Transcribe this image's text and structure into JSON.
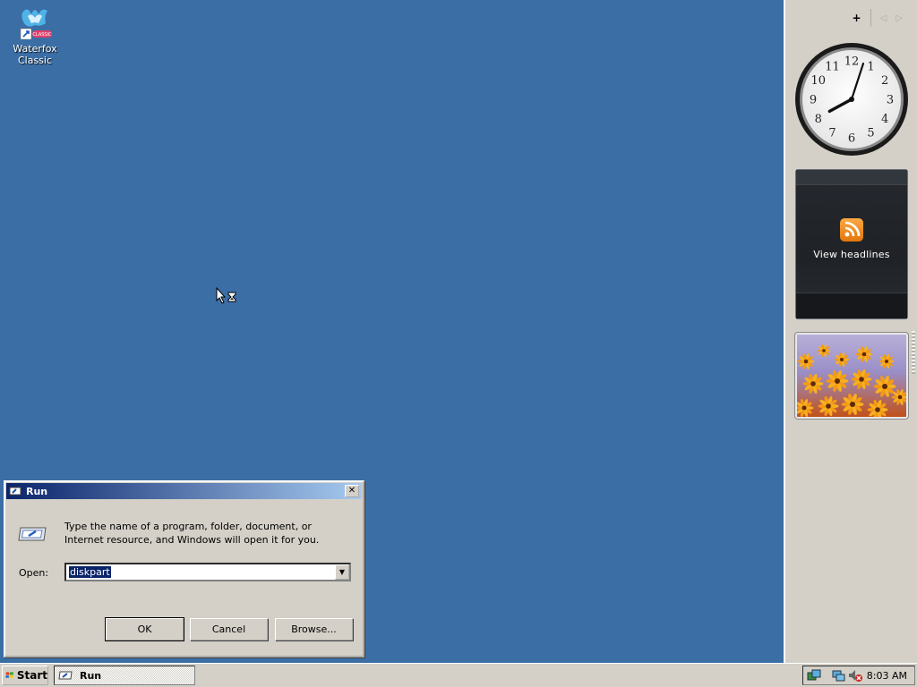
{
  "desktop": {
    "icons": [
      {
        "label_line1": "Waterfox",
        "label_line2": "Classic",
        "badge": "CLASSIC",
        "icon": "waterfox-icon"
      }
    ],
    "background_color": "#3b6ea5"
  },
  "sidebar": {
    "controls": {
      "add": "+",
      "prev": "◁",
      "next": "▷"
    },
    "clock": {
      "numerals": [
        "12",
        "1",
        "2",
        "3",
        "4",
        "5",
        "6",
        "7",
        "8",
        "9",
        "10",
        "11"
      ],
      "hour": 8,
      "minute": 3
    },
    "feed": {
      "caption": "View headlines",
      "icon": "rss-icon"
    },
    "slideshow": {
      "icon": "flower-photo"
    }
  },
  "run_dialog": {
    "title": "Run",
    "close_label": "✕",
    "description": "Type the name of a program, folder, document, or Internet resource, and Windows will open it for you.",
    "open_label": "Open:",
    "open_value": "diskpart",
    "buttons": {
      "ok": "OK",
      "cancel": "Cancel",
      "browse": "Browse..."
    }
  },
  "taskbar": {
    "start_label": "Start",
    "tasks": [
      {
        "label": "Run",
        "icon": "run-icon"
      }
    ],
    "tray": {
      "icons": [
        "network-icon",
        "network-disconnected-icon",
        "volume-muted-icon"
      ],
      "time": "8:03 AM"
    }
  }
}
